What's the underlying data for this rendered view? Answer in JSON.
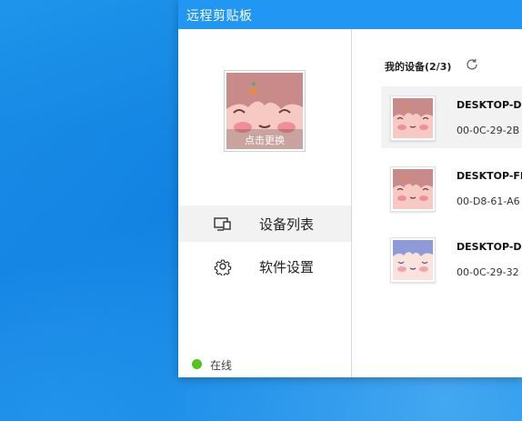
{
  "window": {
    "title": "远程剪贴板"
  },
  "profile": {
    "avatar_caption": "点击更换",
    "avatar_icon": "character-avatar"
  },
  "nav": [
    {
      "label": "设备列表",
      "icon": "device-list-icon",
      "active": true
    },
    {
      "label": "软件设置",
      "icon": "gear-icon",
      "active": false
    }
  ],
  "status": {
    "label": "在线",
    "color": "#52c41a"
  },
  "devices_section": {
    "title": "我的设备(2/3)",
    "icon": "refresh-icon"
  },
  "devices": [
    {
      "name": "DESKTOP-D",
      "mac": "00-0C-29-2B",
      "avatar": "character-avatar-pink",
      "selected": true
    },
    {
      "name": "DESKTOP-FI",
      "mac": "00-D8-61-A6",
      "avatar": "character-avatar-pink",
      "selected": false
    },
    {
      "name": "DESKTOP-D",
      "mac": "00-0C-29-32",
      "avatar": "character-avatar-blue",
      "selected": false
    }
  ],
  "colors": {
    "titlebar": "#2196f3",
    "online": "#52c41a",
    "selected_bg": "#f2f2f2"
  }
}
